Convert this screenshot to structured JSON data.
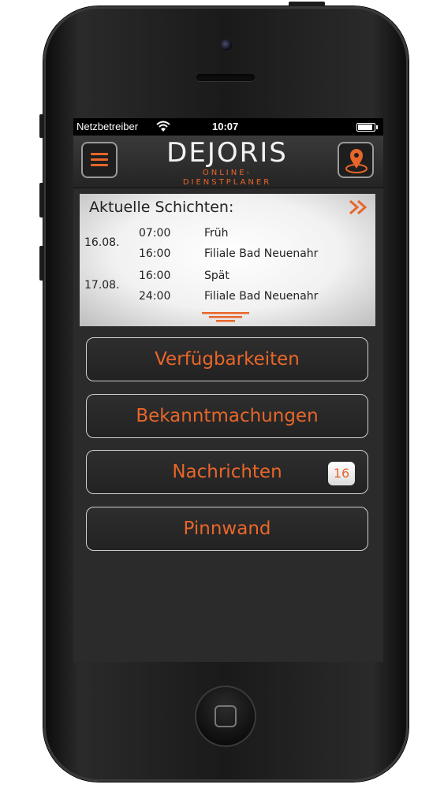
{
  "status_bar": {
    "carrier": "Netzbetreiber",
    "time": "10:07"
  },
  "header": {
    "logo_main": "DEJORIS",
    "logo_sub": "ONLINE-DIENSTPLANER"
  },
  "shifts": {
    "title": "Aktuelle Schichten:",
    "rows": [
      {
        "date": "16.08.",
        "start": "07:00",
        "end": "16:00",
        "type": "Früh",
        "location": "Filiale Bad Neuenahr"
      },
      {
        "date": "17.08.",
        "start": "16:00",
        "end": "24:00",
        "type": "Spät",
        "location": "Filiale Bad Neuenahr"
      }
    ]
  },
  "menu": {
    "availability": "Verfügbarkeiten",
    "announcements": "Bekanntmachungen",
    "messages": "Nachrichten",
    "messages_badge": "16",
    "pinboard": "Pinnwand"
  },
  "colors": {
    "accent": "#e8662a",
    "background": "#2b2b2b"
  }
}
